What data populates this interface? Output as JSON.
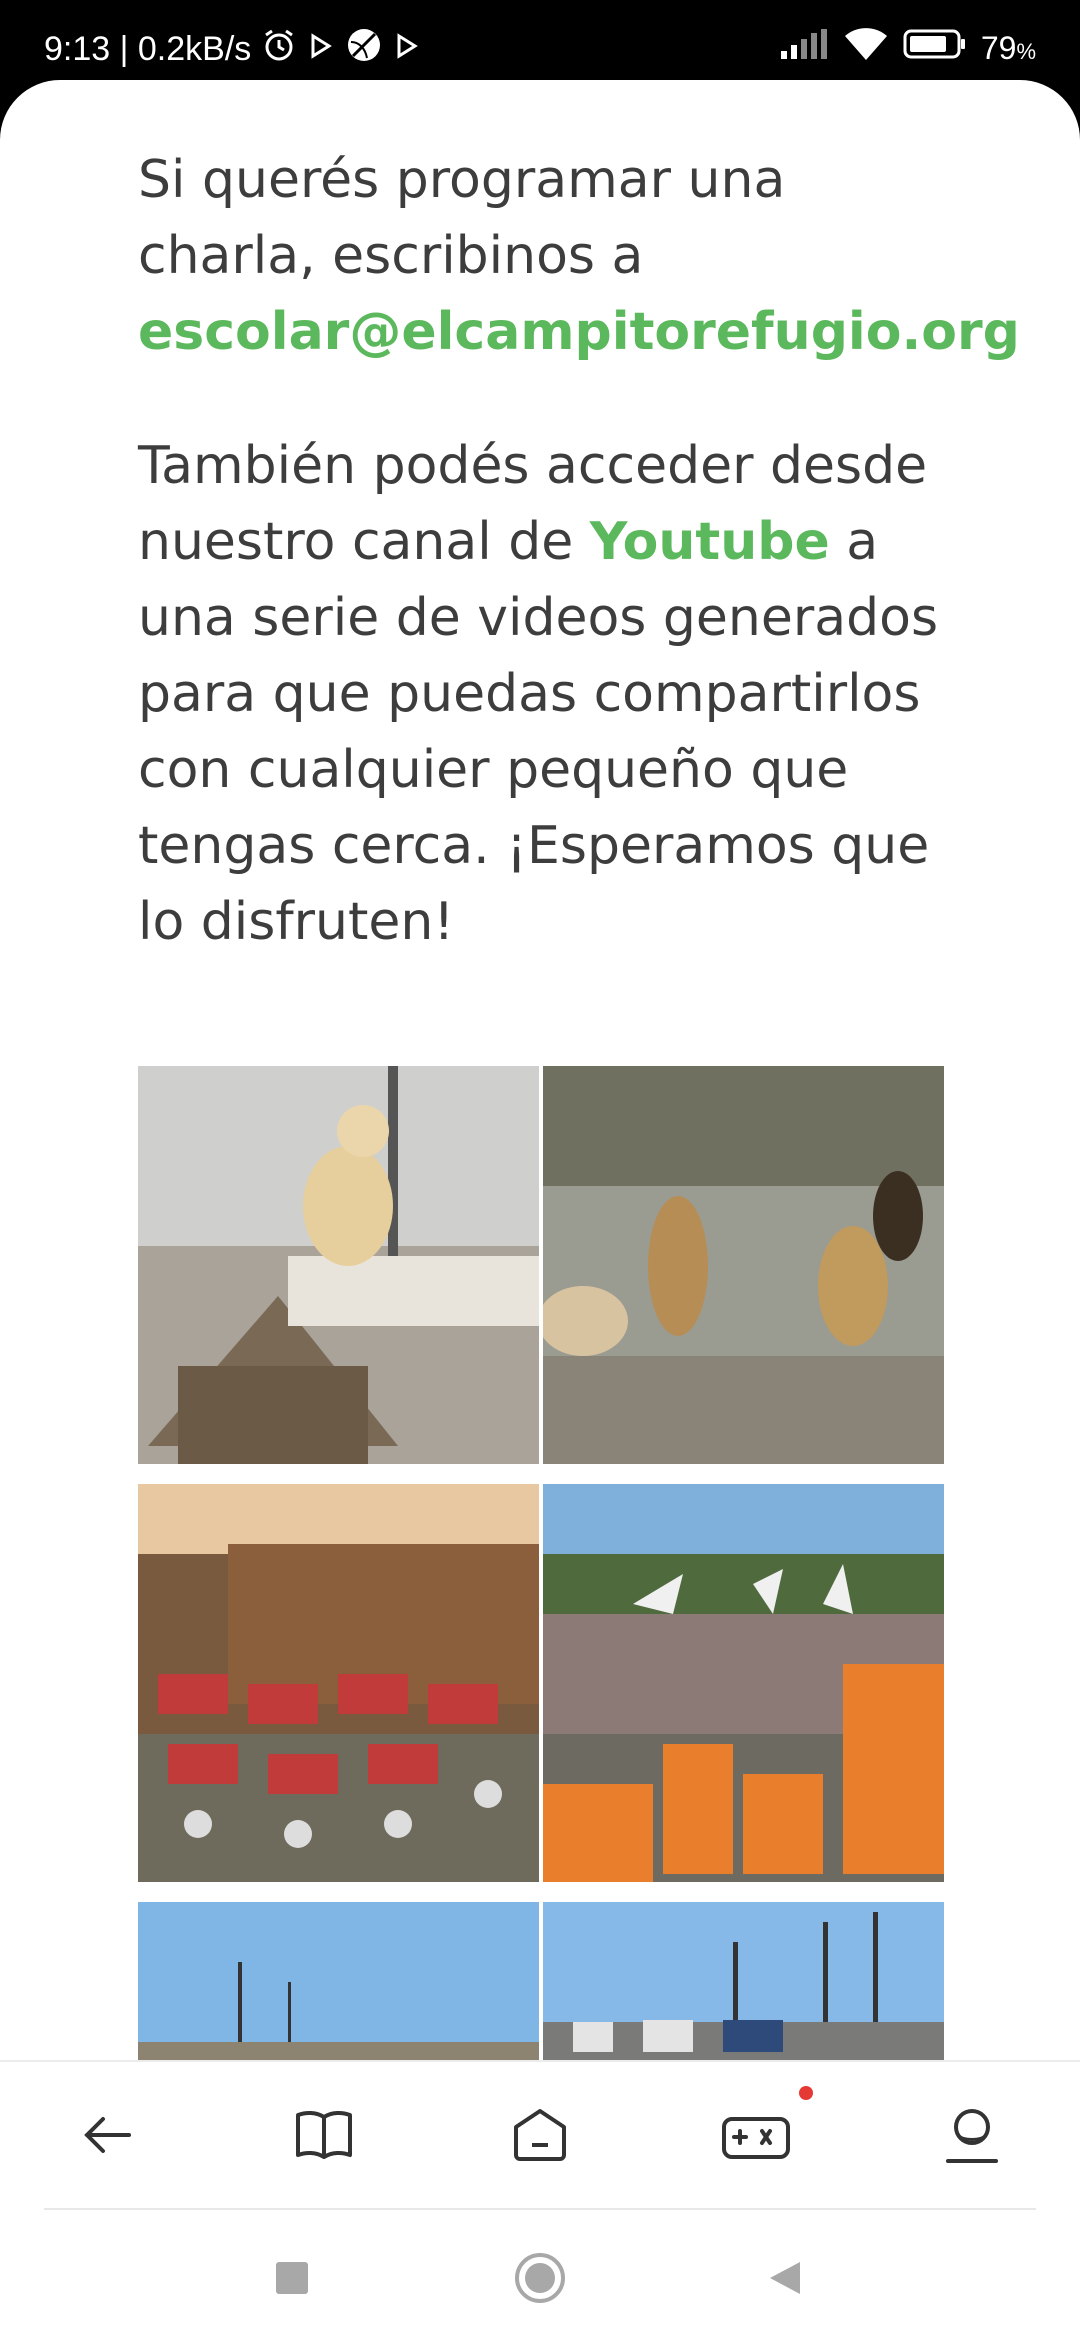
{
  "status_bar": {
    "time_speed": "9:13 | 0.2kB/s",
    "battery": "79",
    "battery_unit": "%"
  },
  "content": {
    "intro_text": "Si querés programar una charla, escribinos a ",
    "email": "escolar@elcampitorefugio.org",
    "body_before": "También podés acceder desde nuestro canal de ",
    "youtube_link": "Youtube",
    "body_after": " a una serie de videos generados para que puedas compartirlos con cualquier pequeño que tengas cerca. ¡Esperamos que lo disfruten!"
  },
  "accent_color": "#5cb85c",
  "icons": {
    "status": [
      "alarm-icon",
      "play-icon",
      "sport-icon",
      "play-icon",
      "signal-icon",
      "wifi-icon",
      "battery-icon"
    ],
    "bottom_nav": [
      "back-arrow-icon",
      "book-icon",
      "home-icon",
      "gamepad-icon",
      "profile-icon"
    ],
    "system_nav": [
      "square-icon",
      "circle-icon",
      "triangle-back-icon"
    ]
  }
}
